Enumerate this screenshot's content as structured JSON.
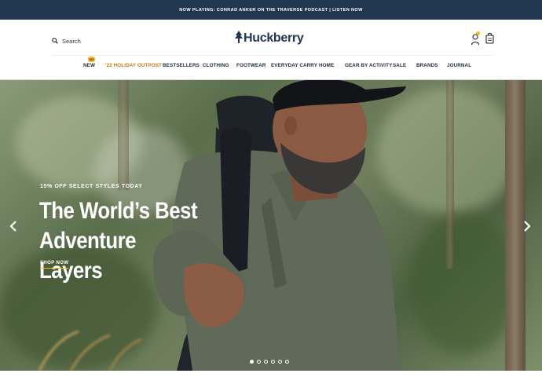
{
  "promo": {
    "text": "NOW PLAYING: CONRAD ANKER ON THE TRAVERSE PODCAST | LISTEN NOW"
  },
  "header": {
    "search_label": "Search",
    "logo_text": "Huckberry",
    "icons": {
      "search": "search-icon",
      "logo": "tree-icon",
      "account": "user-icon",
      "cart": "cart-icon"
    },
    "account_notification_color": "#f5b820"
  },
  "nav": {
    "new_badge": "333",
    "items": [
      {
        "label": "NEW"
      },
      {
        "label": "'22 HOLIDAY OUTPOST"
      },
      {
        "label": "BESTSELLERS"
      },
      {
        "label": "CLOTHING"
      },
      {
        "label": "FOOTWEAR"
      },
      {
        "label": "EVERYDAY CARRY"
      },
      {
        "label": "HOME"
      },
      {
        "label": "GEAR BY ACTIVITY"
      },
      {
        "label": "SALE"
      },
      {
        "label": "BRANDS"
      },
      {
        "label": "JOURNAL"
      }
    ],
    "highlight_color": "#c97a10"
  },
  "hero": {
    "eyebrow": "15% OFF SELECT STYLES TODAY",
    "title_line1": "The World’s Best Adventure",
    "title_line2": "Layers",
    "cta": "SHOP NOW",
    "cta_underline_color": "#f5b820",
    "carousel": {
      "total": 6,
      "active": 1
    },
    "icons": {
      "prev": "chevron-left-icon",
      "next": "chevron-right-icon"
    }
  },
  "colors": {
    "brand_navy": "#21374f",
    "accent_yellow": "#f5b820"
  }
}
